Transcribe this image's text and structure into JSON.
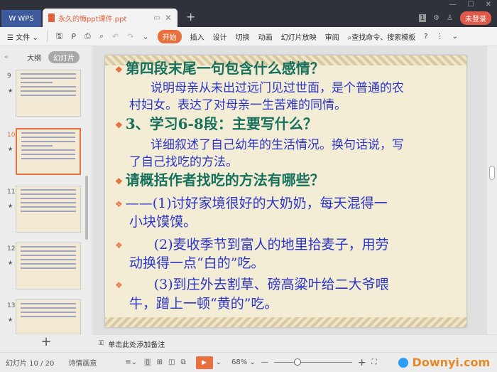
{
  "titlebar": {
    "app": "WPS",
    "doc_tab": "永久的悔ppt课件.ppt",
    "login": "未登录",
    "page_badge": "1"
  },
  "toolbar": {
    "menu": "文件",
    "tabs": [
      "开始",
      "插入",
      "设计",
      "切换",
      "动画",
      "幻灯片放映",
      "审阅"
    ],
    "search": "查找命令、搜索模板",
    "help": "?"
  },
  "left_panel": {
    "tabs": [
      "大纲",
      "幻灯片"
    ],
    "thumbs": [
      {
        "num": "9"
      },
      {
        "num": "10"
      },
      {
        "num": "11"
      },
      {
        "num": "12"
      },
      {
        "num": "13"
      }
    ],
    "star": "★",
    "add": "+"
  },
  "slide": {
    "title1": "第四段末尾一句包含什么感情？",
    "p1a": "说明母亲从未出过远门见过世面，是个普通的农",
    "p1b": "村妇女。表达了对母亲一生苦难的同情。",
    "title2": "3、学习6-8段：主要写什么？",
    "p2a": "详细叙述了自己幼年的生活情况。换句话说，写",
    "p2b": "了自己找吃的方法。",
    "title3": "请概括作者找吃的方法有哪些？",
    "i1a": "——(1)讨好家境很好的大奶奶，每天混得一",
    "i1b": "小块馍馍。",
    "i2a": "(2)麦收季节到富人的地里拾麦子，用劳",
    "i2b": "动换得一点“白的”吃。",
    "i3a": "(3)到庄外去割草、磅高粱叶给二大爷喂",
    "i3b": "牛，蹭上一顿“黄的”吃。"
  },
  "notes": {
    "placeholder": "单击此处添加备注"
  },
  "status": {
    "slide_count": "幻灯片 10 / 20",
    "theme": "诗情画意",
    "zoom": "68%",
    "zoom_value": 68,
    "watermark": "Downyi.com"
  }
}
